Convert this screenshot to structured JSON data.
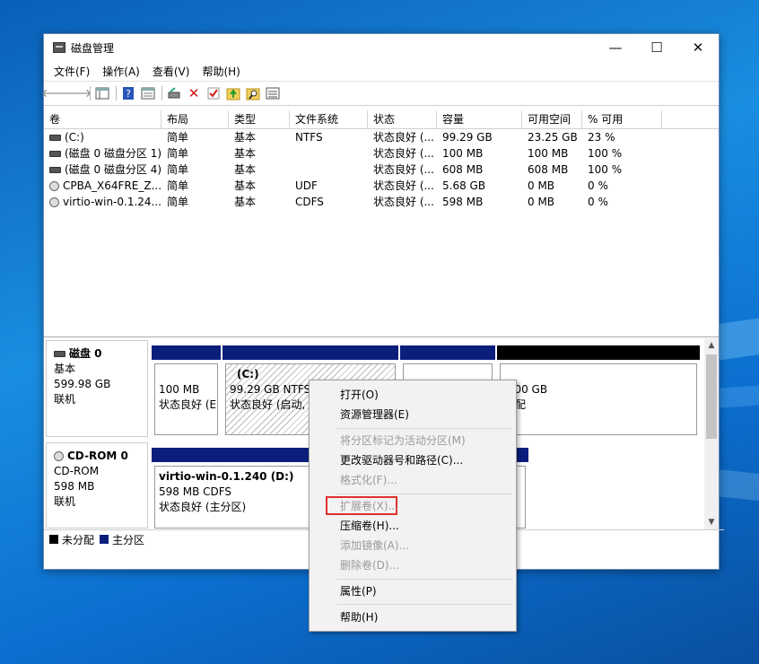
{
  "window": {
    "title": "磁盘管理",
    "buttons": {
      "minimize": "—",
      "maximize": "☐",
      "close": "✕"
    }
  },
  "menubar": [
    "文件(F)",
    "操作(A)",
    "查看(V)",
    "帮助(H)"
  ],
  "toolbar_icons": [
    "back-icon",
    "forward-icon",
    "console-tree-icon",
    "help-icon",
    "properties-icon",
    "connect-disk-icon",
    "delete-icon",
    "check-icon",
    "folder-up-icon",
    "search-folder-icon",
    "list-icon"
  ],
  "volume_list": {
    "columns": [
      "卷",
      "布局",
      "类型",
      "文件系统",
      "状态",
      "容量",
      "可用空间",
      "% 可用"
    ],
    "rows": [
      {
        "icon": "drive-icon",
        "cells": [
          "(C:)",
          "简单",
          "基本",
          "NTFS",
          "状态良好 (...",
          "99.29 GB",
          "23.25 GB",
          "23 %"
        ]
      },
      {
        "icon": "drive-icon",
        "cells": [
          "(磁盘 0 磁盘分区 1)",
          "简单",
          "基本",
          "",
          "状态良好 (...",
          "100 MB",
          "100 MB",
          "100 %"
        ]
      },
      {
        "icon": "drive-icon",
        "cells": [
          "(磁盘 0 磁盘分区 4)",
          "简单",
          "基本",
          "",
          "状态良好 (...",
          "608 MB",
          "608 MB",
          "100 %"
        ]
      },
      {
        "icon": "cd-icon",
        "cells": [
          "CPBA_X64FRE_Z...",
          "简单",
          "基本",
          "UDF",
          "状态良好 (...",
          "5.68 GB",
          "0 MB",
          "0 %"
        ]
      },
      {
        "icon": "cd-icon",
        "cells": [
          "virtio-win-0.1.24...",
          "简单",
          "基本",
          "CDFS",
          "状态良好 (...",
          "598 MB",
          "0 MB",
          "0 %"
        ]
      }
    ]
  },
  "disks": [
    {
      "name": "磁盘 0",
      "type": "基本",
      "size": "599.98 GB",
      "status": "联机",
      "partitions": [
        {
          "line1": "",
          "line2": "100 MB",
          "line3": "状态良好 (E"
        },
        {
          "line1": "(C:)",
          "line2": "99.29 GB NTFS",
          "line3": "状态良好 (启动, 页"
        },
        {
          "line1": "",
          "line2": "",
          "line3": ""
        },
        {
          "line1": "",
          "line2": "0.00 GB",
          "line3": "分配"
        }
      ]
    },
    {
      "name": "CD-ROM 0",
      "type": "CD-ROM",
      "size": "598 MB",
      "status": "联机",
      "partitions": [
        {
          "line1": "virtio-win-0.1.240  (D:)",
          "line2": "598 MB CDFS",
          "line3": "状态良好 (主分区)"
        }
      ]
    }
  ],
  "legend": [
    {
      "label": "未分配",
      "color": "#000000"
    },
    {
      "label": "主分区",
      "color": "#0a1e7c"
    }
  ],
  "context_menu": {
    "items": [
      {
        "label": "打开(O)",
        "disabled": false
      },
      {
        "label": "资源管理器(E)",
        "disabled": false
      },
      {
        "label": "将分区标记为活动分区(M)",
        "disabled": true
      },
      {
        "label": "更改驱动器号和路径(C)...",
        "disabled": false
      },
      {
        "label": "格式化(F)...",
        "disabled": true
      },
      {
        "label": "扩展卷(X)...",
        "disabled": true
      },
      {
        "label": "压缩卷(H)...",
        "disabled": false
      },
      {
        "label": "添加镜像(A)...",
        "disabled": true
      },
      {
        "label": "删除卷(D)...",
        "disabled": true
      },
      {
        "label": "属性(P)",
        "disabled": false
      },
      {
        "label": "帮助(H)",
        "disabled": false
      }
    ]
  },
  "colors": {
    "primary_partition": "#0a1e7c",
    "unallocated": "#000000",
    "highlight_box": "#e03030"
  }
}
